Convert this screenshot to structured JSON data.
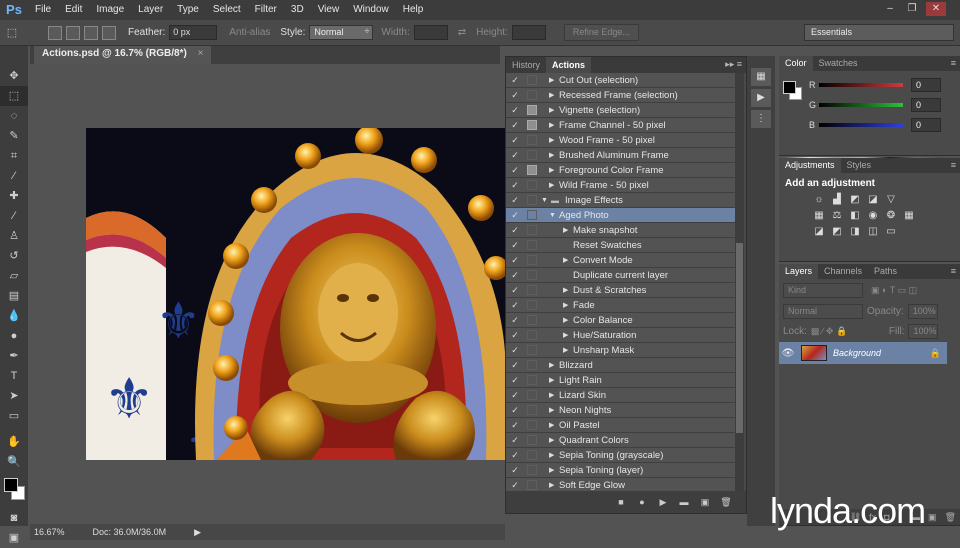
{
  "app": {
    "logo": "Ps"
  },
  "menu": [
    "File",
    "Edit",
    "Image",
    "Layer",
    "Type",
    "Select",
    "Filter",
    "3D",
    "View",
    "Window",
    "Help"
  ],
  "window_controls": [
    "–",
    "❐",
    "✕"
  ],
  "options": {
    "feather_label": "Feather:",
    "feather_value": "0 px",
    "antialias_label": "Anti-alias",
    "style_label": "Style:",
    "style_value": "Normal",
    "width_label": "Width:",
    "height_label": "Height:",
    "refine_label": "Refine Edge...",
    "workspace": "Essentials"
  },
  "document": {
    "tab": "Actions.psd @ 16.7% (RGB/8*)",
    "close": "×"
  },
  "status": {
    "zoom": "16.67%",
    "doc": "Doc: 36.0M/36.0M"
  },
  "actions_panel": {
    "tabs": [
      "History",
      "Actions"
    ],
    "rows": [
      {
        "label": "Cut Out (selection)",
        "level": 1,
        "dialog": false,
        "tri": "▶"
      },
      {
        "label": "Recessed Frame (selection)",
        "level": 1,
        "dialog": false,
        "tri": "▶"
      },
      {
        "label": "Vignette (selection)",
        "level": 1,
        "dialog": true,
        "tri": "▶"
      },
      {
        "label": "Frame Channel - 50 pixel",
        "level": 1,
        "dialog": true,
        "tri": "▶"
      },
      {
        "label": "Wood Frame - 50 pixel",
        "level": 1,
        "dialog": false,
        "tri": "▶"
      },
      {
        "label": "Brushed Aluminum Frame",
        "level": 1,
        "dialog": false,
        "tri": "▶"
      },
      {
        "label": "Foreground Color Frame",
        "level": 1,
        "dialog": true,
        "tri": "▶"
      },
      {
        "label": "Wild Frame - 50 pixel",
        "level": 1,
        "dialog": false,
        "tri": "▶"
      },
      {
        "label": "Image Effects",
        "level": 0,
        "dialog": false,
        "tri": "▼",
        "folder": true
      },
      {
        "label": "Aged Photo",
        "level": 1,
        "dialog": false,
        "tri": "▼",
        "selected": true
      },
      {
        "label": "Make snapshot",
        "level": 2,
        "dialog": false,
        "tri": "▶"
      },
      {
        "label": "Reset Swatches",
        "level": 2,
        "dialog": false,
        "tri": ""
      },
      {
        "label": "Convert Mode",
        "level": 2,
        "dialog": false,
        "tri": "▶"
      },
      {
        "label": "Duplicate current layer",
        "level": 2,
        "dialog": false,
        "tri": ""
      },
      {
        "label": "Dust & Scratches",
        "level": 2,
        "dialog": false,
        "tri": "▶"
      },
      {
        "label": "Fade",
        "level": 2,
        "dialog": false,
        "tri": "▶"
      },
      {
        "label": "Color Balance",
        "level": 2,
        "dialog": false,
        "tri": "▶"
      },
      {
        "label": "Hue/Saturation",
        "level": 2,
        "dialog": false,
        "tri": "▶"
      },
      {
        "label": "Unsharp Mask",
        "level": 2,
        "dialog": false,
        "tri": "▶"
      },
      {
        "label": "Blizzard",
        "level": 1,
        "dialog": false,
        "tri": "▶"
      },
      {
        "label": "Light Rain",
        "level": 1,
        "dialog": false,
        "tri": "▶"
      },
      {
        "label": "Lizard Skin",
        "level": 1,
        "dialog": false,
        "tri": "▶"
      },
      {
        "label": "Neon Nights",
        "level": 1,
        "dialog": false,
        "tri": "▶"
      },
      {
        "label": "Oil Pastel",
        "level": 1,
        "dialog": false,
        "tri": "▶"
      },
      {
        "label": "Quadrant Colors",
        "level": 1,
        "dialog": false,
        "tri": "▶"
      },
      {
        "label": "Sepia Toning (grayscale)",
        "level": 1,
        "dialog": false,
        "tri": "▶"
      },
      {
        "label": "Sepia Toning (layer)",
        "level": 1,
        "dialog": false,
        "tri": "▶"
      },
      {
        "label": "Soft Edge Glow",
        "level": 1,
        "dialog": false,
        "tri": "▶"
      }
    ]
  },
  "color_panel": {
    "tabs": [
      "Color",
      "Swatches"
    ],
    "channels": [
      {
        "label": "R",
        "value": "0",
        "color": "#d23a3a"
      },
      {
        "label": "G",
        "value": "0",
        "color": "#2fbf3a"
      },
      {
        "label": "B",
        "value": "0",
        "color": "#2f3fe0"
      }
    ]
  },
  "adjustments_panel": {
    "tabs": [
      "Adjustments",
      "Styles"
    ],
    "title": "Add an adjustment"
  },
  "layers_panel": {
    "tabs": [
      "Layers",
      "Channels",
      "Paths"
    ],
    "kind": "Kind",
    "blend": "Normal",
    "opacity_label": "Opacity:",
    "opacity_value": "100%",
    "lock_label": "Lock:",
    "fill_label": "Fill:",
    "fill_value": "100%",
    "layer_name": "Background"
  },
  "watermark": "lynda.com",
  "colors": {
    "selection": "#6c82a5",
    "accent": "#6fb6ff"
  }
}
